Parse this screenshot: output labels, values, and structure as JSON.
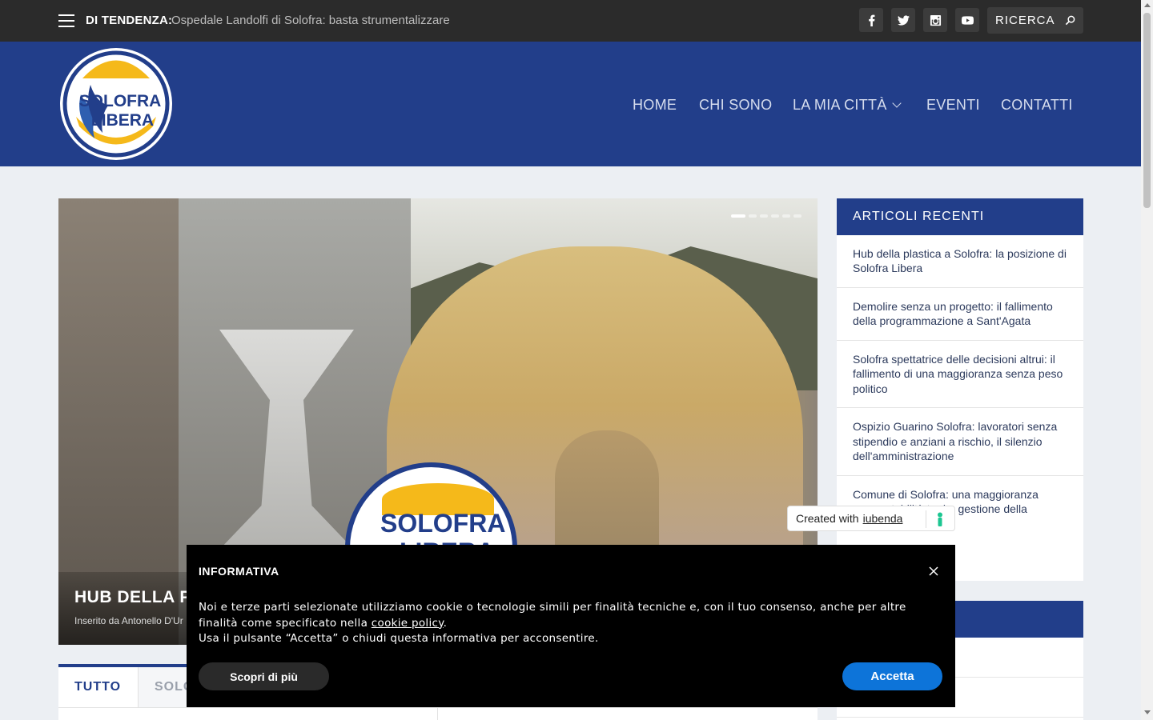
{
  "topbar": {
    "trending_label": "DI TENDENZA:",
    "trending_text": "Ospedale Landolfi di Solofra: basta strumentalizzare",
    "social": [
      "facebook-icon",
      "twitter-icon",
      "instagram-icon",
      "youtube-icon"
    ],
    "search_placeholder": "RICERCA"
  },
  "header": {
    "logo_line1": "SOLOFRA",
    "logo_line2": "LIBERA",
    "nav": [
      {
        "label": "HOME"
      },
      {
        "label": "CHI SONO"
      },
      {
        "label": "LA MIA CITTÀ"
      },
      {
        "label": "EVENTI"
      },
      {
        "label": "CONTATTI"
      }
    ]
  },
  "hero": {
    "title": "HUB DELLA PL",
    "meta": "Inserito da Antonello D'Ur",
    "logo_line1": "SOLOFRA",
    "logo_line2": "LIBERA",
    "slides": 6,
    "active_slide": 1
  },
  "tabs": [
    {
      "label": "TUTTO"
    },
    {
      "label": "SOLO"
    }
  ],
  "sidebar": {
    "title": "ARTICOLI RECENTI",
    "items": [
      "Hub della plastica a Solofra: la posizione di Solofra Libera",
      "Demolire senza un progetto: il fallimento della programmazione a Sant'Agata",
      "Solofra spettatrice delle decisioni altrui: il fallimento di una maggioranza senza peso politico",
      "Ospizio Guarino Solofra: lavoratori senza stipendio e anziani a rischio, il silenzio dell'amministrazione",
      "Comune di Solofra: una maggioranza senza stabilità tra i... gestione della"
    ]
  },
  "iubenda": {
    "prefix": "Created with",
    "link": "iubenda"
  },
  "cookie": {
    "title": "INFORMATIVA",
    "text_part1": "Noi e terze parti selezionate utilizziamo cookie o tecnologie simili per finalità tecniche e, con il tuo consenso, anche per altre finalità come specificato nella ",
    "link": "cookie policy",
    "text_part2": ".",
    "text_line2": "Usa il pulsante “Accetta” o chiudi questa informativa per acconsentire.",
    "more_label": "Scopri di più",
    "accept_label": "Accetta"
  },
  "colors": {
    "brand_blue": "#223e8a",
    "accept_blue": "#0d74d9",
    "topbar": "#2b2b2b",
    "logo_yellow": "#f5b91a"
  }
}
